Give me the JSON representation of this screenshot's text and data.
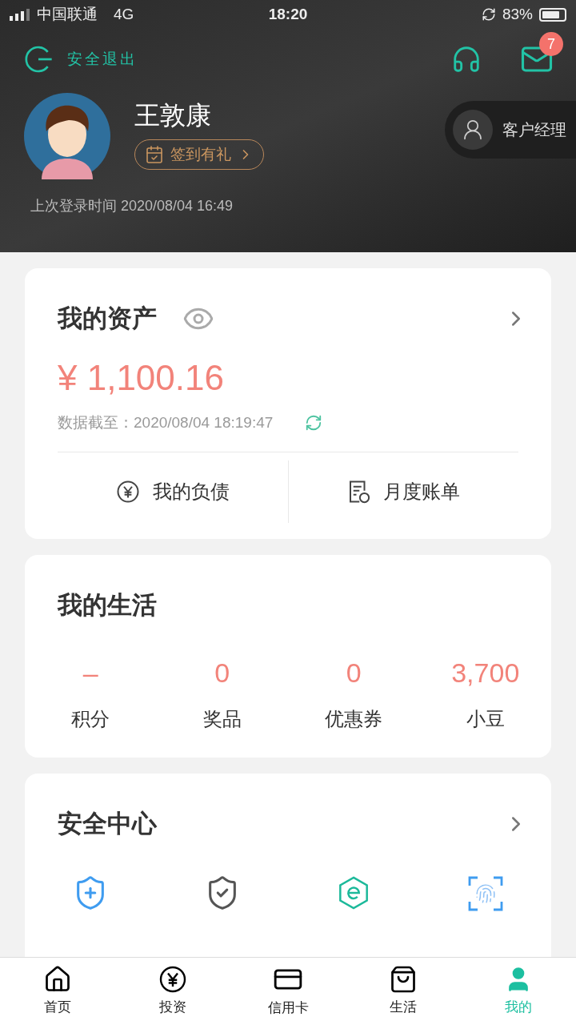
{
  "status_bar": {
    "carrier": "中国联通",
    "network": "4G",
    "time": "18:20",
    "battery": "83%"
  },
  "header": {
    "logout": "安全退出",
    "message_badge": "7",
    "user_name": "王敦康",
    "checkin": "签到有礼",
    "manager": "客户经理",
    "last_login": "上次登录时间 2020/08/04 16:49"
  },
  "assets": {
    "title": "我的资产",
    "amount": "¥ 1,100.16",
    "updated": "数据截至：2020/08/04 18:19:47",
    "links": [
      "我的负债",
      "月度账单"
    ]
  },
  "life": {
    "title": "我的生活",
    "stats": [
      {
        "value": "–",
        "label": "积分"
      },
      {
        "value": "0",
        "label": "奖品"
      },
      {
        "value": "0",
        "label": "优惠券"
      },
      {
        "value": "3,700",
        "label": "小豆"
      }
    ]
  },
  "security": {
    "title": "安全中心",
    "tools": [
      {
        "kind": "switch"
      },
      {
        "kind": "account"
      },
      {
        "kind": "pay"
      },
      {
        "kind": "biometric"
      }
    ]
  },
  "tabs": [
    {
      "label": "首页",
      "kind": "home",
      "selected": false
    },
    {
      "label": "投资",
      "kind": "invest",
      "selected": false
    },
    {
      "label": "信用卡",
      "kind": "card",
      "selected": false
    },
    {
      "label": "生活",
      "kind": "life",
      "selected": false
    },
    {
      "label": "我的",
      "kind": "me",
      "selected": true
    }
  ]
}
